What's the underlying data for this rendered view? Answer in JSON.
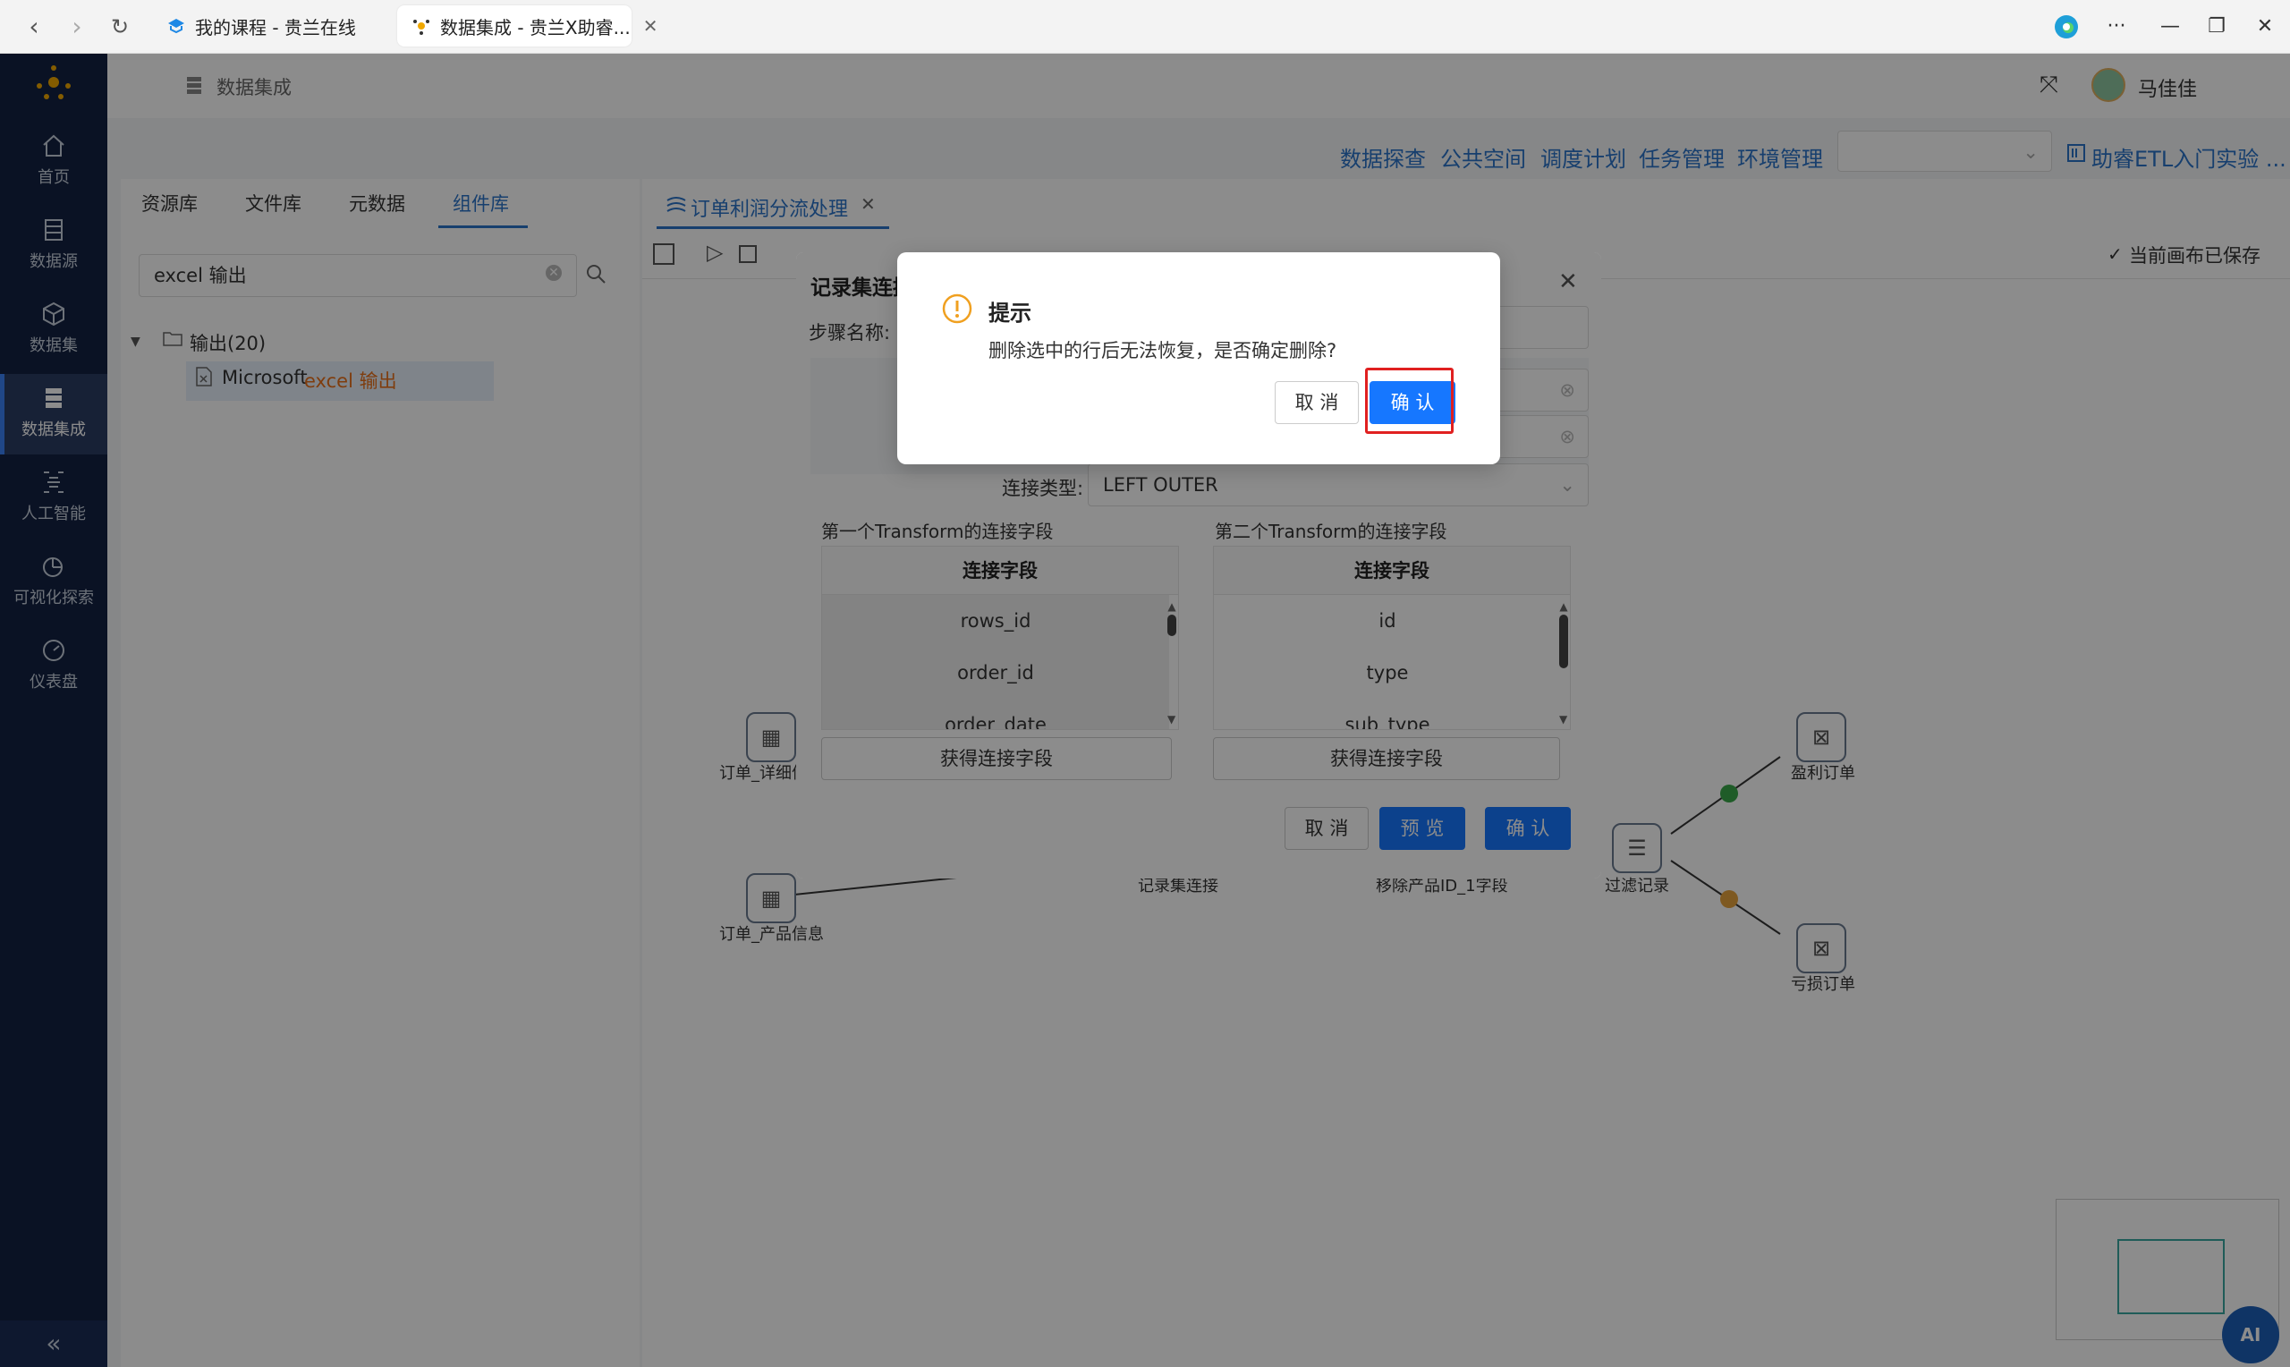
{
  "browser": {
    "tabs": [
      {
        "title": "我的课程 - 贵兰在线"
      },
      {
        "title": "数据集成 - 贵兰X助睿..."
      }
    ],
    "colors": {
      "accent": "#1677ff",
      "sidebar": "#132243"
    }
  },
  "sidebar": {
    "items": [
      {
        "label": "首页",
        "icon": "home-icon"
      },
      {
        "label": "数据源",
        "icon": "database-icon"
      },
      {
        "label": "数据集",
        "icon": "cube-icon"
      },
      {
        "label": "数据集成",
        "icon": "server-icon"
      },
      {
        "label": "人工智能",
        "icon": "ai-icon"
      },
      {
        "label": "可视化探索",
        "icon": "pie-chart-icon"
      },
      {
        "label": "仪表盘",
        "icon": "gauge-icon"
      }
    ],
    "active": "数据集成"
  },
  "header": {
    "breadcrumb": "数据集成",
    "user": "马佳佳"
  },
  "toplinks": [
    "数据探查",
    "公共空间",
    "调度计划",
    "任务管理",
    "环境管理"
  ],
  "project_title": "助睿ETL入门实验 ...",
  "left_panel": {
    "tabs": [
      "资源库",
      "文件库",
      "元数据",
      "组件库"
    ],
    "active_tab": "组件库",
    "search_value": "excel 输出",
    "tree": {
      "folder": "输出(20)",
      "item_prefix": "Microsoft ",
      "item_highlight": "excel 输出"
    }
  },
  "canvas": {
    "tab_title": "订单利润分流处理",
    "saved_status": "当前画布已保存",
    "nodes": [
      {
        "label": "订单_详细信息"
      },
      {
        "label": "订单_产品信息"
      },
      {
        "label": "记录集连接"
      },
      {
        "label": "移除产品ID_1字段"
      },
      {
        "label": "过滤记录"
      },
      {
        "label": "盈利订单"
      },
      {
        "label": "亏损订单"
      }
    ]
  },
  "dialog": {
    "title": "记录集连接",
    "step_name_label": "步骤名称:",
    "join_type_label": "连接类型:",
    "join_type_value": "LEFT OUTER",
    "first_transform_label": "第一个Transform的连接字段",
    "second_transform_label": "第二个Transform的连接字段",
    "column_header": "连接字段",
    "first_rows": [
      "rows_id",
      "order_id",
      "order_date"
    ],
    "second_rows": [
      "id",
      "type",
      "sub_type"
    ],
    "get_fields_button": "获得连接字段",
    "cancel": "取 消",
    "preview": "预 览",
    "confirm": "确 认"
  },
  "alert": {
    "title": "提示",
    "message": "删除选中的行后无法恢复，是否确定删除?",
    "cancel": "取 消",
    "confirm": "确 认"
  },
  "ai_button": "AI"
}
